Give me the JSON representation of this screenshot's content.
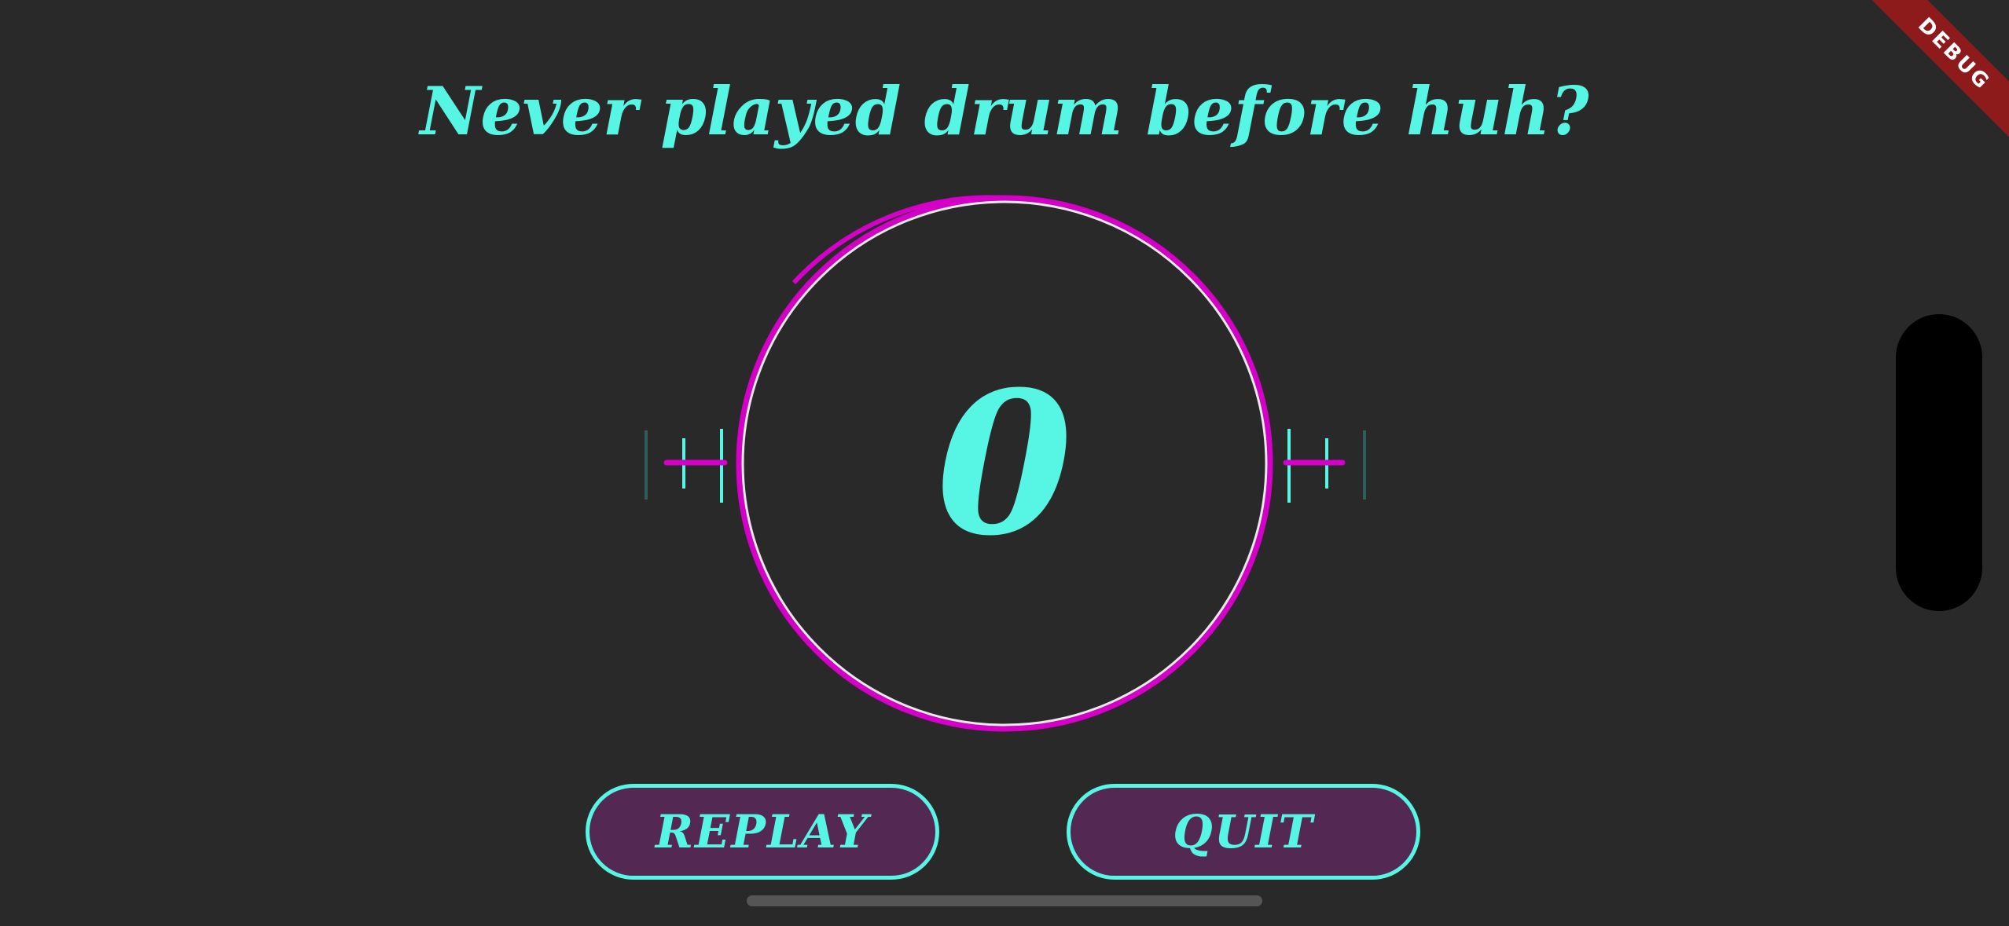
{
  "headline": "Never played drum before huh?",
  "score": "0",
  "buttons": {
    "replay_label": "REPLAY",
    "quit_label": "QUIT"
  },
  "debug_banner": "DEBUG",
  "colors": {
    "background": "#292929",
    "accent_cyan": "#57F5E3",
    "accent_magenta": "#D400C8",
    "button_fill": "#532852",
    "debug_banner": "#8E1B1B"
  },
  "icons": {
    "left_beat_marker": "beat-marker-icon",
    "right_beat_marker": "beat-marker-icon"
  }
}
